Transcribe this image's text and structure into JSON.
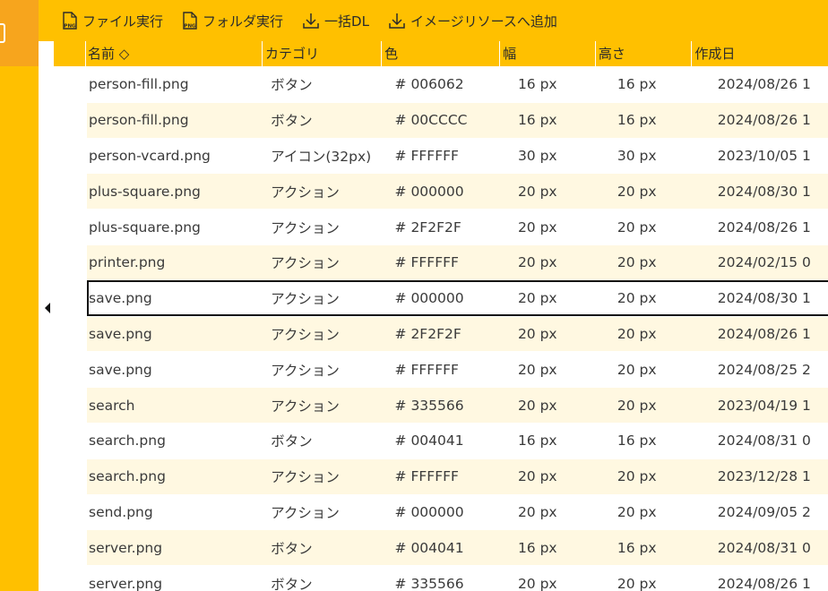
{
  "toolbar": {
    "buttons": [
      {
        "label": "ファイル実行",
        "icon": "png-file-icon"
      },
      {
        "label": "フォルダ実行",
        "icon": "png-file-icon"
      },
      {
        "label": "一括DL",
        "icon": "download-icon"
      },
      {
        "label": "イメージリソースへ追加",
        "icon": "download-icon"
      }
    ]
  },
  "columns": [
    "名前 ◇",
    "カテゴリ",
    "色",
    "幅",
    "高さ",
    "作成日"
  ],
  "rows": [
    {
      "name": "person-fill.png",
      "category": "ボタン",
      "color": "# 006062",
      "width": "16 px",
      "height": "16 px",
      "created": "2024/08/26 1"
    },
    {
      "name": "person-fill.png",
      "category": "ボタン",
      "color": "# 00CCCC",
      "width": "16 px",
      "height": "16 px",
      "created": "2024/08/26 1"
    },
    {
      "name": "person-vcard.png",
      "category": "アイコン(32px)",
      "color": "# FFFFFF",
      "width": "30 px",
      "height": "30 px",
      "created": "2023/10/05 1"
    },
    {
      "name": "plus-square.png",
      "category": "アクション",
      "color": "# 000000",
      "width": "20 px",
      "height": "20 px",
      "created": "2024/08/30 1"
    },
    {
      "name": "plus-square.png",
      "category": "アクション",
      "color": "# 2F2F2F",
      "width": "20 px",
      "height": "20 px",
      "created": "2024/08/26 1"
    },
    {
      "name": "printer.png",
      "category": "アクション",
      "color": "# FFFFFF",
      "width": "20 px",
      "height": "20 px",
      "created": "2024/02/15 0"
    },
    {
      "name": "save.png",
      "category": "アクション",
      "color": "# 000000",
      "width": "20 px",
      "height": "20 px",
      "created": "2024/08/30 1"
    },
    {
      "name": "save.png",
      "category": "アクション",
      "color": "# 2F2F2F",
      "width": "20 px",
      "height": "20 px",
      "created": "2024/08/26 1"
    },
    {
      "name": "save.png",
      "category": "アクション",
      "color": "# FFFFFF",
      "width": "20 px",
      "height": "20 px",
      "created": "2024/08/25 2"
    },
    {
      "name": "search",
      "category": "アクション",
      "color": "# 335566",
      "width": "20 px",
      "height": "20 px",
      "created": "2023/04/19 1"
    },
    {
      "name": "search.png",
      "category": "ボタン",
      "color": "# 004041",
      "width": "16 px",
      "height": "16 px",
      "created": "2024/08/31 0"
    },
    {
      "name": "search.png",
      "category": "アクション",
      "color": "# FFFFFF",
      "width": "20 px",
      "height": "20 px",
      "created": "2023/12/28 1"
    },
    {
      "name": "send.png",
      "category": "アクション",
      "color": "# 000000",
      "width": "20 px",
      "height": "20 px",
      "created": "2024/09/05 2"
    },
    {
      "name": "server.png",
      "category": "ボタン",
      "color": "# 004041",
      "width": "16 px",
      "height": "16 px",
      "created": "2024/08/31 0"
    },
    {
      "name": "server.png",
      "category": "ボタン",
      "color": "# 335566",
      "width": "20 px",
      "height": "20 px",
      "created": "2024/08/26 1"
    }
  ],
  "current_row_index": 6,
  "colors": {
    "accent": "#ffc000",
    "accent_dark": "#f7a51d",
    "row_alt": "#fff8e1",
    "text": "#333333"
  }
}
